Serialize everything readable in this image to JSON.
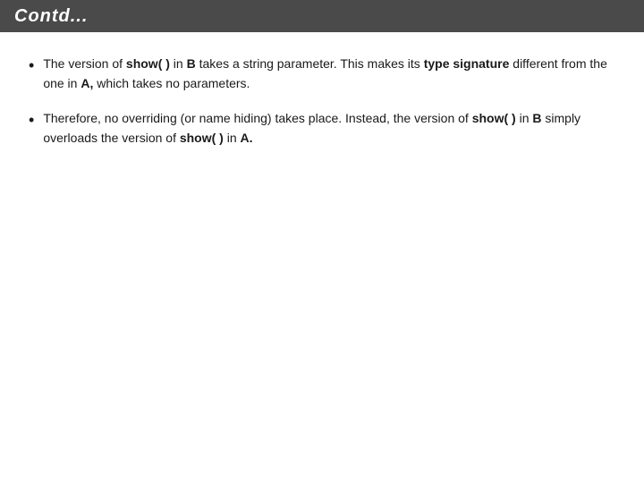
{
  "header": {
    "title": "Contd..."
  },
  "content": {
    "bullet1": {
      "part1": "The version of ",
      "code1": "show( )",
      "part2": " in ",
      "code2": "B",
      "part3": " takes a string parameter. This makes its ",
      "highlight1": "type signature",
      "part4": " different from the one in ",
      "code3": "A,",
      "part5": " which takes no parameters."
    },
    "bullet2": {
      "part1": "Therefore, no overriding (or name hiding) takes place. Instead, the version of ",
      "code1": "show( )",
      "part2": " in ",
      "code2": "B",
      "part3": " simply overloads the version of ",
      "code3": "show( )",
      "part4": " in ",
      "code4": "A."
    }
  }
}
